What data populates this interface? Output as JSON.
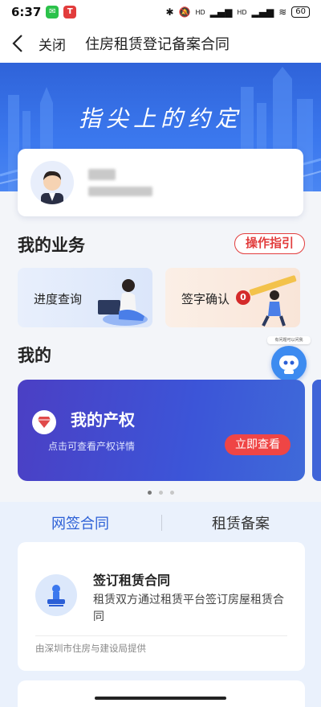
{
  "status_bar": {
    "time": "6:37",
    "battery": "60",
    "app_badges": [
      {
        "icon": "wechat-icon",
        "color": "#2bc24a"
      },
      {
        "icon": "app-icon",
        "color": "#e23c3c"
      }
    ],
    "signal_labels": [
      "HD",
      "HD"
    ]
  },
  "nav": {
    "close_label": "关闭",
    "title": "住房租赁登记备案合同"
  },
  "banner": {
    "title": "指尖上的约定"
  },
  "my_business": {
    "title": "我的业务",
    "guide_label": "操作指引",
    "cards": [
      {
        "label": "进度查询"
      },
      {
        "label": "签字确认",
        "badge": "0"
      }
    ]
  },
  "robot": {
    "tip": "有问题可以问我"
  },
  "mine": {
    "title": "我的",
    "property": {
      "title": "我的产权",
      "subtitle": "点击可查看产权详情",
      "button": "立即查看"
    }
  },
  "tabs": [
    {
      "label": "网签合同",
      "active": true
    },
    {
      "label": "租赁备案",
      "active": false
    }
  ],
  "contract": {
    "title": "签订租赁合同",
    "description": "租赁双方通过租赁平台签订房屋租赁合同",
    "provider": "由深圳市住房与建设局提供"
  },
  "colors": {
    "brand_blue": "#2b5fd6",
    "accent_red": "#e23d3d"
  }
}
